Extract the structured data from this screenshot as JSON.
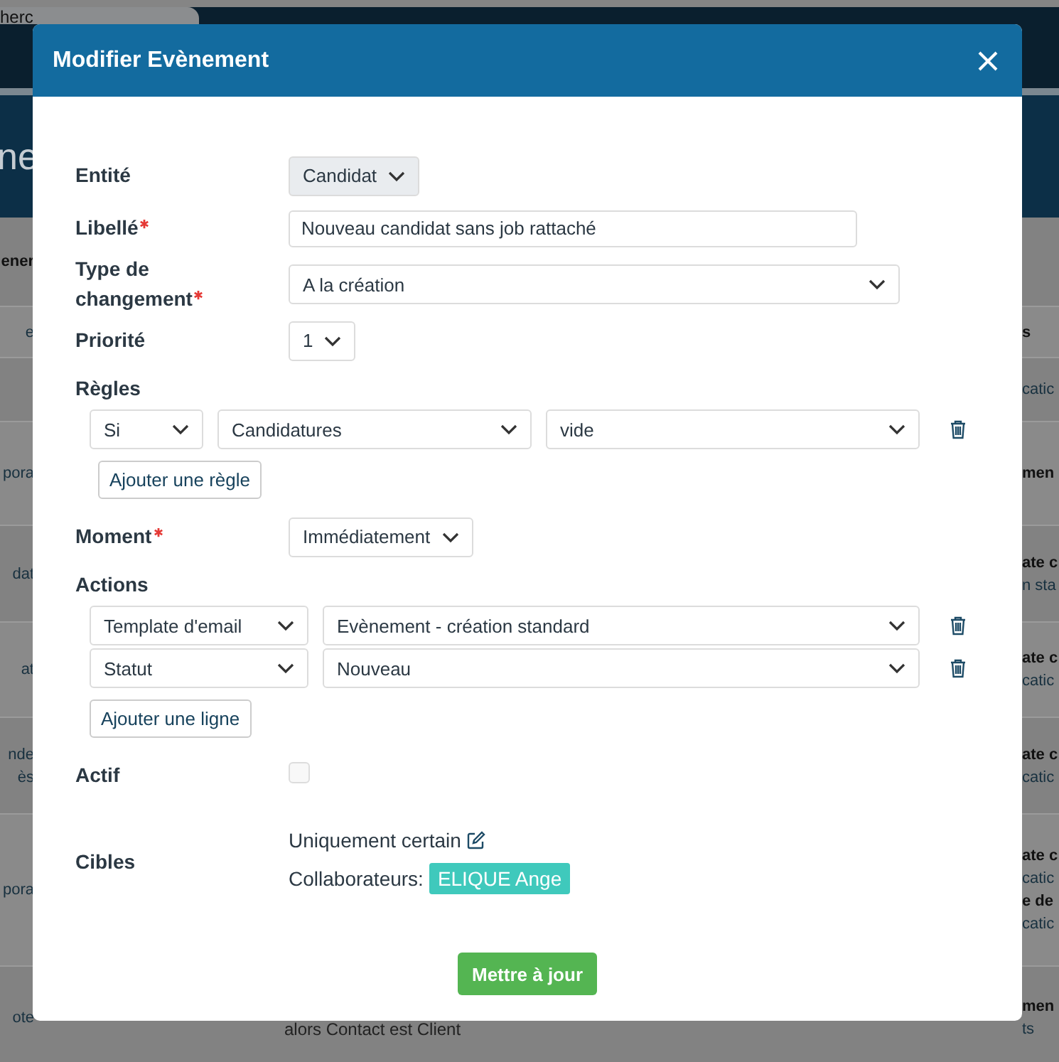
{
  "background_page": {
    "search_tab": "herc",
    "page_title": "ne",
    "table": {
      "header": {
        "left": "ener"
      },
      "rows": [
        {
          "left": [
            "e"
          ],
          "middle": [],
          "right": [
            {
              "text": "s",
              "bold": true
            }
          ]
        },
        {
          "left": [],
          "middle": [],
          "right": [
            {
              "text": "catic",
              "bold": false
            }
          ]
        },
        {
          "left": [
            "pora"
          ],
          "middle": [],
          "right": [
            {
              "text": "men",
              "bold": true
            }
          ]
        },
        {
          "left": [
            "dat"
          ],
          "middle": [],
          "right": [
            {
              "text": "ate c",
              "bold": true
            },
            {
              "text": "n sta",
              "bold": false
            }
          ]
        },
        {
          "left": [
            "at"
          ],
          "middle": [],
          "right": [
            {
              "text": "ate c",
              "bold": true
            },
            {
              "text": "catic",
              "bold": false
            }
          ]
        },
        {
          "left": [
            "nde",
            "ès"
          ],
          "middle": [],
          "right": [
            {
              "text": "ate c",
              "bold": true
            },
            {
              "text": "catic",
              "bold": false
            }
          ]
        },
        {
          "left": [
            "pora"
          ],
          "middle": [],
          "right": [
            {
              "text": "ate c",
              "bold": true
            },
            {
              "text": "catic",
              "bold": false
            },
            {
              "text": "e de",
              "bold": true
            },
            {
              "text": "catic",
              "bold": false
            }
          ]
        },
        {
          "left": [
            "ote"
          ],
          "middle": [
            "alors Contact est Client"
          ],
          "right": [
            {
              "text": "men",
              "bold": true
            },
            {
              "text": "ts",
              "bold": false
            }
          ]
        }
      ]
    }
  },
  "dialog": {
    "title": "Modifier Evènement",
    "fields": [
      {
        "kind": "select",
        "label": "Entité",
        "required": false,
        "value": "Candidat",
        "disabled": true
      },
      {
        "kind": "text",
        "label": "Libellé",
        "required": true,
        "value": "Nouveau candidat sans job rattaché"
      },
      {
        "kind": "select-wide",
        "label": "Type de changement",
        "required": true,
        "value": "A la création",
        "disabled": false
      },
      {
        "kind": "select",
        "label": "Priorité",
        "required": false,
        "value": "1",
        "disabled": false
      },
      {
        "kind": "rules",
        "label": "Règles",
        "required": false,
        "rows": [
          [
            "Si",
            "Candidatures",
            "vide"
          ]
        ],
        "add_button": "Ajouter une règle"
      },
      {
        "kind": "select",
        "label": "Moment",
        "required": true,
        "value": "Immédiatement",
        "disabled": false
      },
      {
        "kind": "actions",
        "label": "Actions",
        "required": false,
        "rows": [
          [
            "Template d'email",
            "Evènement - création standard"
          ],
          [
            "Statut",
            "Nouveau"
          ]
        ],
        "add_button": "Ajouter une ligne"
      },
      {
        "kind": "checkbox",
        "label": "Actif",
        "required": false,
        "checked": false
      },
      {
        "kind": "targets",
        "label": "Cibles",
        "required": false,
        "mode": "Uniquement certain",
        "group_label": "Collaborateurs:",
        "tags": [
          "ELIQUE Ange"
        ]
      }
    ],
    "submit": "Mettre à jour"
  }
}
